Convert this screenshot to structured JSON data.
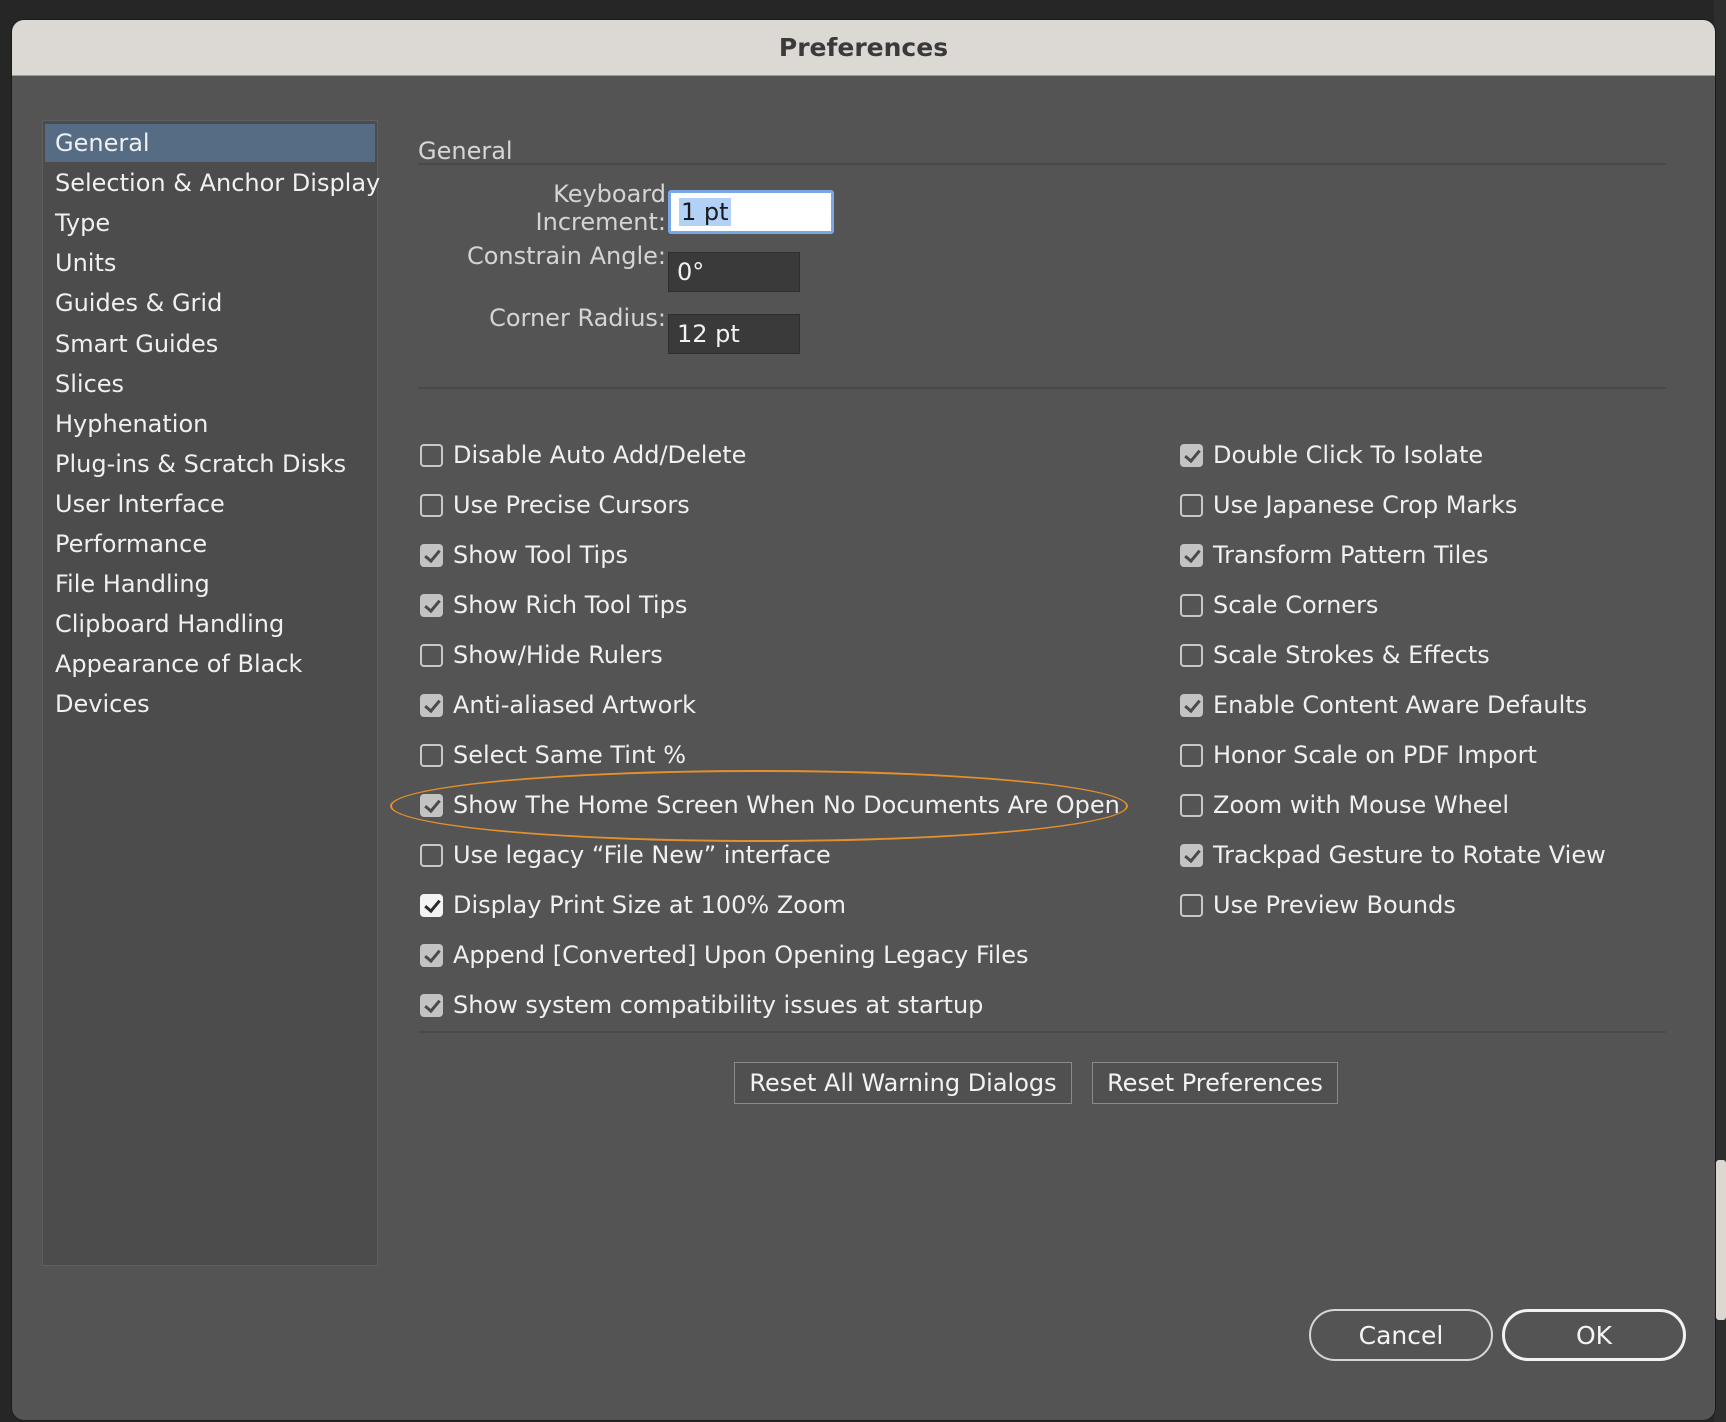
{
  "window": {
    "title": "Preferences"
  },
  "sidebar": {
    "items": [
      {
        "label": "General",
        "selected": true
      },
      {
        "label": "Selection & Anchor Display"
      },
      {
        "label": "Type"
      },
      {
        "label": "Units"
      },
      {
        "label": "Guides & Grid"
      },
      {
        "label": "Smart Guides"
      },
      {
        "label": "Slices"
      },
      {
        "label": "Hyphenation"
      },
      {
        "label": "Plug-ins & Scratch Disks"
      },
      {
        "label": "User Interface"
      },
      {
        "label": "Performance"
      },
      {
        "label": "File Handling"
      },
      {
        "label": "Clipboard Handling"
      },
      {
        "label": "Appearance of Black"
      },
      {
        "label": "Devices"
      }
    ]
  },
  "general": {
    "section_title": "General",
    "fields": {
      "keyboard_increment": {
        "label": "Keyboard Increment:",
        "value": "1 pt"
      },
      "constrain_angle": {
        "label": "Constrain Angle:",
        "value": "0°"
      },
      "corner_radius": {
        "label": "Corner Radius:",
        "value": "12 pt"
      }
    },
    "left_options": [
      {
        "label": "Disable Auto Add/Delete",
        "checked": false
      },
      {
        "label": "Use Precise Cursors",
        "checked": false
      },
      {
        "label": "Show Tool Tips",
        "checked": true
      },
      {
        "label": "Show Rich Tool Tips",
        "checked": true
      },
      {
        "label": "Show/Hide Rulers",
        "checked": false
      },
      {
        "label": "Anti-aliased Artwork",
        "checked": true
      },
      {
        "label": "Select Same Tint %",
        "checked": false
      },
      {
        "label": "Show The Home Screen When No Documents Are Open",
        "checked": true
      },
      {
        "label": "Use legacy “File New” interface",
        "checked": false
      },
      {
        "label": "Display Print Size at 100% Zoom",
        "checked": true
      },
      {
        "label": "Append [Converted] Upon Opening Legacy Files",
        "checked": true
      },
      {
        "label": "Show system compatibility issues at startup",
        "checked": true
      }
    ],
    "right_options": [
      {
        "label": "Double Click To Isolate",
        "checked": true
      },
      {
        "label": "Use Japanese Crop Marks",
        "checked": false
      },
      {
        "label": "Transform Pattern Tiles",
        "checked": true
      },
      {
        "label": "Scale Corners",
        "checked": false
      },
      {
        "label": "Scale Strokes & Effects",
        "checked": false
      },
      {
        "label": "Enable Content Aware Defaults",
        "checked": true
      },
      {
        "label": "Honor Scale on PDF Import",
        "checked": false
      },
      {
        "label": "Zoom with Mouse Wheel",
        "checked": false
      },
      {
        "label": "Trackpad Gesture to Rotate View",
        "checked": true
      },
      {
        "label": "Use Preview Bounds",
        "checked": false
      }
    ],
    "reset_warnings_label": "Reset All Warning Dialogs",
    "reset_preferences_label": "Reset Preferences"
  },
  "footer": {
    "cancel_label": "Cancel",
    "ok_label": "OK"
  },
  "colors": {
    "dialog_bg": "#545454",
    "sidebar_selected": "#566c85",
    "highlight_annotation": "#e4902c",
    "titlebar_bg": "#dcd8d3"
  }
}
